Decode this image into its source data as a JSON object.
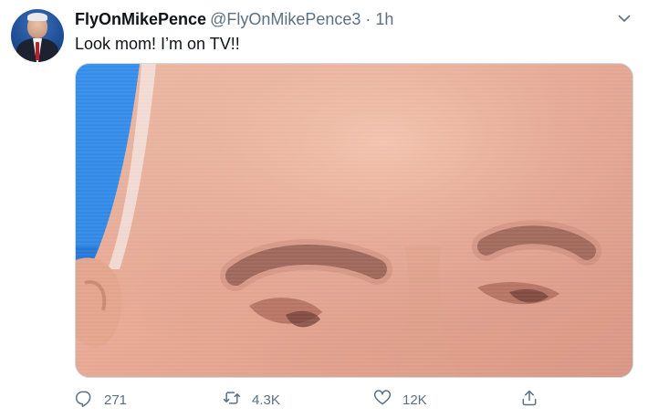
{
  "tweet": {
    "author": {
      "display_name": "FlyOnMikePence",
      "handle": "@FlyOnMikePence3",
      "avatar_icon": "profile-photo"
    },
    "separator": "·",
    "timestamp": "1h",
    "text": "Look mom! I’m on TV!!",
    "media": {
      "type": "photo",
      "icon": "photo-closeup-face"
    },
    "actions": {
      "reply": {
        "icon": "reply-icon",
        "count": "271"
      },
      "retweet": {
        "icon": "retweet-icon",
        "count": "4.3K"
      },
      "like": {
        "icon": "heart-icon",
        "count": "12K"
      },
      "share": {
        "icon": "share-icon"
      }
    },
    "menu_icon": "chevron-down-icon"
  },
  "colors": {
    "text": "#0f1419",
    "secondary": "#5b7083",
    "border": "#cfd9de"
  }
}
